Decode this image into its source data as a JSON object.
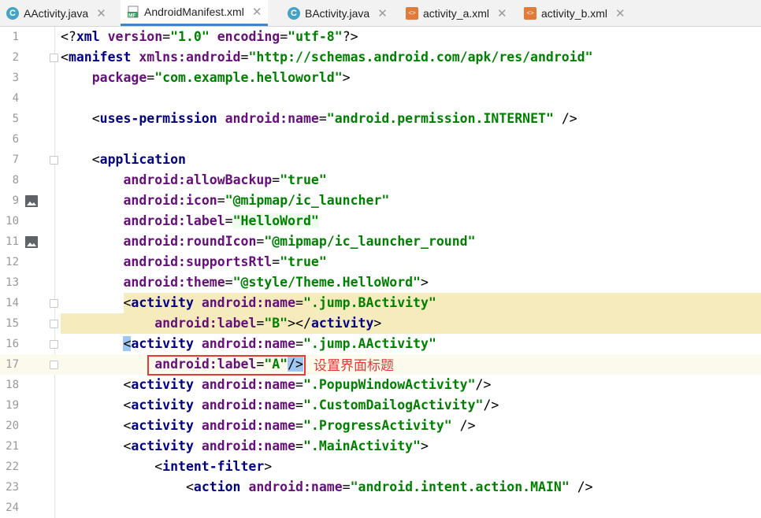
{
  "tabs": [
    {
      "label": "AActivity.java",
      "icon": "java-class-icon",
      "active": false
    },
    {
      "label": "AndroidManifest.xml",
      "icon": "manifest-file-icon",
      "active": true
    },
    {
      "label": "BActivity.java",
      "icon": "java-class-icon",
      "active": false
    },
    {
      "label": "activity_a.xml",
      "icon": "xml-layout-icon",
      "active": false
    },
    {
      "label": "activity_b.xml",
      "icon": "xml-layout-icon",
      "active": false
    }
  ],
  "tab_close_glyph": "✕",
  "tab_icon_letters": {
    "java": "C",
    "manifest": "MF",
    "xml": "<>"
  },
  "annotation": {
    "text": "设置界面标题",
    "color": "#e53935"
  },
  "colors": {
    "tag": "#000080",
    "attr": "#660e7a",
    "string": "#008000",
    "highlight": "#f6ebbc",
    "accent": "#4083c9"
  },
  "lines": [
    {
      "n": "1",
      "tokens": [
        [
          "<?",
          "pi"
        ],
        [
          "xml ",
          "tag"
        ],
        [
          "version",
          "attr"
        ],
        [
          "=",
          "plain"
        ],
        [
          "\"1.0\"",
          "str"
        ],
        [
          " ",
          "plain"
        ],
        [
          "encoding",
          "attr"
        ],
        [
          "=",
          "plain"
        ],
        [
          "\"utf-8\"",
          "str"
        ],
        [
          "?>",
          "pi"
        ]
      ]
    },
    {
      "n": "2",
      "tokens": [
        [
          "<",
          "plain"
        ],
        [
          "manifest ",
          "tag"
        ],
        [
          "xmlns:",
          "attr"
        ],
        [
          "android",
          "attr"
        ],
        [
          "=",
          "plain"
        ],
        [
          "\"http://schemas.android.com/apk/res/android\"",
          "str"
        ]
      ]
    },
    {
      "n": "3",
      "tokens": [
        [
          "    ",
          "plain"
        ],
        [
          "package",
          "attr"
        ],
        [
          "=",
          "plain"
        ],
        [
          "\"com.example.helloworld\"",
          "str"
        ],
        [
          ">",
          "plain"
        ]
      ]
    },
    {
      "n": "4",
      "tokens": []
    },
    {
      "n": "5",
      "tokens": [
        [
          "    <",
          "plain"
        ],
        [
          "uses-permission ",
          "tag"
        ],
        [
          "android:",
          "ns"
        ],
        [
          "name",
          "attr"
        ],
        [
          "=",
          "plain"
        ],
        [
          "\"android.permission.INTERNET\"",
          "str"
        ],
        [
          " />",
          "plain"
        ]
      ]
    },
    {
      "n": "6",
      "tokens": []
    },
    {
      "n": "7",
      "tokens": [
        [
          "    <",
          "plain"
        ],
        [
          "application",
          "tag"
        ]
      ]
    },
    {
      "n": "8",
      "tokens": [
        [
          "        ",
          "plain"
        ],
        [
          "android:",
          "ns"
        ],
        [
          "allowBackup",
          "attr"
        ],
        [
          "=",
          "plain"
        ],
        [
          "\"true\"",
          "str"
        ]
      ]
    },
    {
      "n": "9",
      "tokens": [
        [
          "        ",
          "plain"
        ],
        [
          "android:",
          "ns"
        ],
        [
          "icon",
          "attr"
        ],
        [
          "=",
          "plain"
        ],
        [
          "\"@mipmap/ic_launcher\"",
          "str"
        ]
      ]
    },
    {
      "n": "10",
      "tokens": [
        [
          "        ",
          "plain"
        ],
        [
          "android:",
          "ns"
        ],
        [
          "label",
          "attr"
        ],
        [
          "=",
          "plain"
        ],
        [
          "\"HelloWord\"",
          "str"
        ]
      ]
    },
    {
      "n": "11",
      "tokens": [
        [
          "        ",
          "plain"
        ],
        [
          "android:",
          "ns"
        ],
        [
          "roundIcon",
          "attr"
        ],
        [
          "=",
          "plain"
        ],
        [
          "\"@mipmap/ic_launcher_round\"",
          "str"
        ]
      ]
    },
    {
      "n": "12",
      "tokens": [
        [
          "        ",
          "plain"
        ],
        [
          "android:",
          "ns"
        ],
        [
          "supportsRtl",
          "attr"
        ],
        [
          "=",
          "plain"
        ],
        [
          "\"true\"",
          "str"
        ]
      ]
    },
    {
      "n": "13",
      "tokens": [
        [
          "        ",
          "plain"
        ],
        [
          "android:",
          "ns"
        ],
        [
          "theme",
          "attr"
        ],
        [
          "=",
          "plain"
        ],
        [
          "\"@style/Theme.HelloWord\"",
          "str"
        ],
        [
          ">",
          "plain"
        ]
      ]
    },
    {
      "n": "14",
      "tokens": [
        [
          "        <",
          "plain"
        ],
        [
          "activity ",
          "tag"
        ],
        [
          "android:",
          "ns"
        ],
        [
          "name",
          "attr"
        ],
        [
          "=",
          "plain"
        ],
        [
          "\".jump.BActivity\"",
          "str"
        ]
      ]
    },
    {
      "n": "15",
      "tokens": [
        [
          "            ",
          "plain"
        ],
        [
          "android:",
          "ns"
        ],
        [
          "label",
          "attr"
        ],
        [
          "=",
          "plain"
        ],
        [
          "\"B\"",
          "str"
        ],
        [
          "></",
          "plain"
        ],
        [
          "activity",
          "tag"
        ],
        [
          ">",
          "plain"
        ]
      ]
    },
    {
      "n": "16",
      "tokens": [
        [
          "        <",
          "plain"
        ],
        [
          "activity ",
          "tag"
        ],
        [
          "android:",
          "ns"
        ],
        [
          "name",
          "attr"
        ],
        [
          "=",
          "plain"
        ],
        [
          "\".jump.AActivity\"",
          "str"
        ]
      ]
    },
    {
      "n": "17",
      "tokens": [
        [
          "            ",
          "plain"
        ],
        [
          "android:",
          "ns"
        ],
        [
          "label",
          "attr"
        ],
        [
          "=",
          "plain"
        ],
        [
          "\"A\"",
          "str"
        ],
        [
          "/>",
          "plain"
        ]
      ]
    },
    {
      "n": "18",
      "tokens": [
        [
          "        <",
          "plain"
        ],
        [
          "activity ",
          "tag"
        ],
        [
          "android:",
          "ns"
        ],
        [
          "name",
          "attr"
        ],
        [
          "=",
          "plain"
        ],
        [
          "\".PopupWindowActivity\"",
          "str"
        ],
        [
          "/>",
          "plain"
        ]
      ]
    },
    {
      "n": "19",
      "tokens": [
        [
          "        <",
          "plain"
        ],
        [
          "activity ",
          "tag"
        ],
        [
          "android:",
          "ns"
        ],
        [
          "name",
          "attr"
        ],
        [
          "=",
          "plain"
        ],
        [
          "\".CustomDailogActivity\"",
          "str"
        ],
        [
          "/>",
          "plain"
        ]
      ]
    },
    {
      "n": "20",
      "tokens": [
        [
          "        <",
          "plain"
        ],
        [
          "activity ",
          "tag"
        ],
        [
          "android:",
          "ns"
        ],
        [
          "name",
          "attr"
        ],
        [
          "=",
          "plain"
        ],
        [
          "\".ProgressActivity\"",
          "str"
        ],
        [
          " />",
          "plain"
        ]
      ]
    },
    {
      "n": "21",
      "tokens": [
        [
          "        <",
          "plain"
        ],
        [
          "activity ",
          "tag"
        ],
        [
          "android:",
          "ns"
        ],
        [
          "name",
          "attr"
        ],
        [
          "=",
          "plain"
        ],
        [
          "\".MainActivity\"",
          "str"
        ],
        [
          ">",
          "plain"
        ]
      ]
    },
    {
      "n": "22",
      "tokens": [
        [
          "            <",
          "plain"
        ],
        [
          "intent-filter",
          "tag"
        ],
        [
          ">",
          "plain"
        ]
      ]
    },
    {
      "n": "23",
      "tokens": [
        [
          "                <",
          "plain"
        ],
        [
          "action ",
          "tag"
        ],
        [
          "android:",
          "ns"
        ],
        [
          "name",
          "attr"
        ],
        [
          "=",
          "plain"
        ],
        [
          "\"android.intent.action.MAIN\"",
          "str"
        ],
        [
          " />",
          "plain"
        ]
      ]
    },
    {
      "n": "24",
      "tokens": []
    }
  ]
}
